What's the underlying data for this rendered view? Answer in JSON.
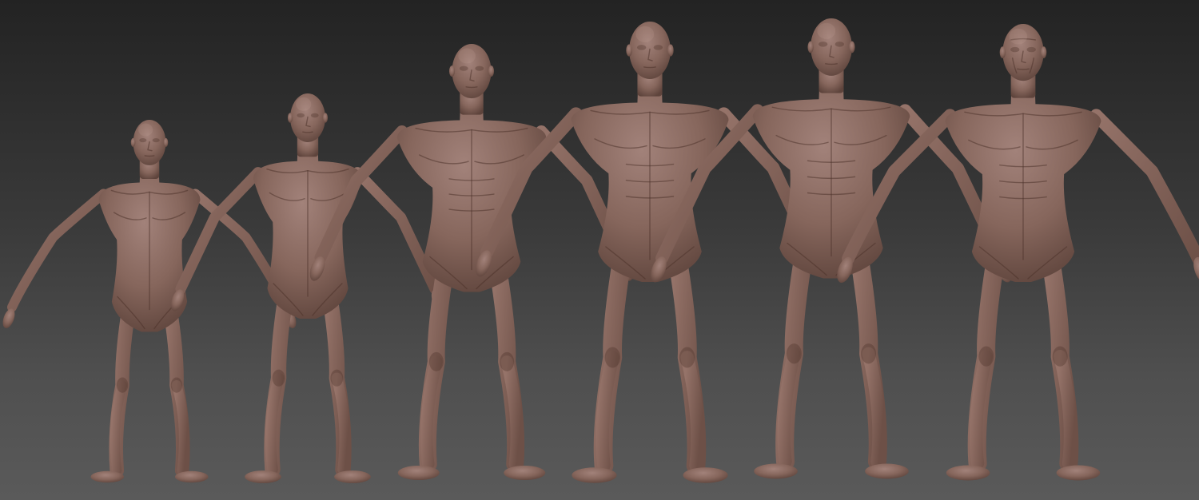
{
  "scene": {
    "background": "#3a3a3a",
    "skin_color": "#8a6a5f",
    "figures": [
      {
        "name": "child",
        "order": 1
      },
      {
        "name": "adolescent",
        "order": 2
      },
      {
        "name": "young-adult",
        "order": 3
      },
      {
        "name": "athletic-adult",
        "order": 4
      },
      {
        "name": "middle-aged-adult",
        "order": 5
      },
      {
        "name": "elderly-adult",
        "order": 6
      }
    ]
  }
}
